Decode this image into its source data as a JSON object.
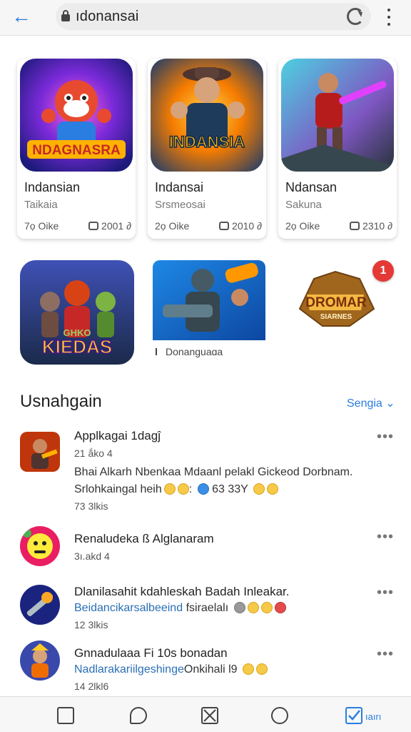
{
  "browser": {
    "url": "ıdonansai",
    "back_icon": "arrow-left-icon",
    "lock_icon": "lock-icon",
    "reload_icon": "reload-icon",
    "menu_icon": "kebab-menu-icon"
  },
  "featured": [
    {
      "art_text": "NDAGNASRA",
      "name": "Indansian",
      "sub": "Taikaia",
      "likes": "7ọ Oike",
      "comments": "2001 ∂"
    },
    {
      "art_text": "INDANSIA",
      "name": "Indansai",
      "sub": "Srsmeosai",
      "likes": "2ọ Oike",
      "comments": "2010 ∂"
    },
    {
      "art_text": "",
      "name": "Ndansan",
      "sub": "Sakuna",
      "likes": "2ọ Oike",
      "comments": "2310 ∂"
    }
  ],
  "tiles": [
    {
      "art_text": "KIEDAS",
      "art_text_top": "GHKO"
    },
    {
      "caption": "Donanguaɑa"
    },
    {
      "art_text": "DROMAR",
      "art_text_sub": "SIARNES"
    }
  ],
  "notification_badge": "1",
  "section": {
    "title": "Usnahgain",
    "sort_label": "Sengia"
  },
  "reviews": [
    {
      "title": "Applkagai 1dagĵ",
      "meta": "21 ắko 4",
      "text": "Bhai Alkarh Nbenkaa Mdaanl pelakl Gickeod Dorbnam.",
      "text2": "Srlohkaingal heih",
      "text2_tail": "63  33Y",
      "footer": "73 3lkis"
    },
    {
      "title": "Renaludeka ß Alglanaram",
      "meta": "3ı.akd 4"
    },
    {
      "title": "Dlanilasahit kdahleskah Badah Inleakar.",
      "link": "Beidancikarsalbeeind",
      "link_tail": "fsiraelalı",
      "footer": "12 3lkis"
    },
    {
      "title": "Gnnadulaaa Fi 10s bonadan",
      "link": "Nadlarakariilgeshinge",
      "link_tail": "Onkihali l9",
      "footer": "14 2lkl6"
    }
  ],
  "more_icon": "more-horizontal-icon",
  "bottom_nav": {
    "items": [
      "home-icon",
      "chat-icon",
      "share-icon",
      "notification-icon",
      "tasks-icon"
    ],
    "active_label": "ıaırı"
  },
  "colors": {
    "accent": "#2a7de1",
    "badge": "#e53935"
  }
}
